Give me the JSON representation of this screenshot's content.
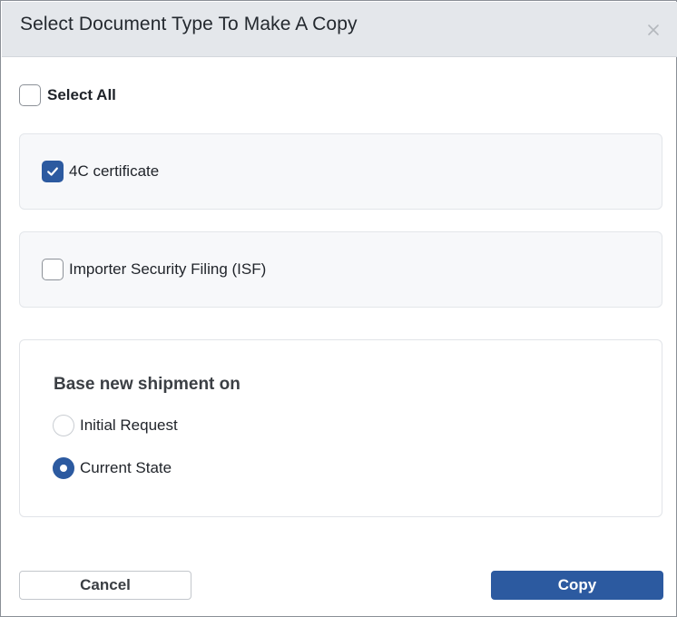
{
  "dialog": {
    "title": "Select Document Type To Make A Copy",
    "close_icon": "close-icon"
  },
  "select_all": {
    "label": "Select All",
    "checked": false
  },
  "documents": [
    {
      "label": "4C certificate",
      "checked": true
    },
    {
      "label": "Importer Security Filing (ISF)",
      "checked": false
    }
  ],
  "base_shipment": {
    "title": "Base new shipment on",
    "options": [
      {
        "label": "Initial Request",
        "selected": false
      },
      {
        "label": "Current State",
        "selected": true
      }
    ]
  },
  "footer": {
    "cancel_label": "Cancel",
    "copy_label": "Copy"
  },
  "colors": {
    "accent": "#2c5aa0",
    "header_bg": "#e4e7eb",
    "card_bg": "#f7f8fa"
  }
}
